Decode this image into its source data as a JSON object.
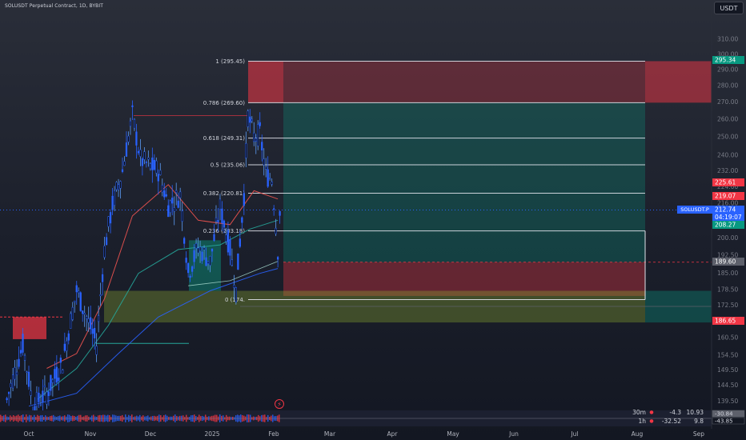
{
  "header": {
    "title": "SOLUSDT Perpetual Contract, 1D, BYBIT",
    "currency": "USDT"
  },
  "symbol_badge": "SOLUSDT.P",
  "chart_data": {
    "type": "candlestick",
    "x_ticks": [
      "Oct",
      "Nov",
      "Dec",
      "2025",
      "Feb",
      "Mar",
      "Apr",
      "May",
      "Jun",
      "Jul",
      "Aug",
      "Sep"
    ],
    "y_scale": "log",
    "y_ticks": [
      "310.00",
      "300.00",
      "290.00",
      "280.00",
      "270.00",
      "260.00",
      "250.00",
      "240.00",
      "232.00",
      "224.00",
      "216.00",
      "208.00",
      "200.00",
      "192.50",
      "185.00",
      "178.50",
      "172.50",
      "166.50",
      "160.50",
      "154.50",
      "149.50",
      "144.50",
      "139.50"
    ],
    "price_labels": [
      {
        "value": "295.34",
        "color": "#089981"
      },
      {
        "value": "225.61",
        "color": "#f23645"
      },
      {
        "value": "219.07",
        "color": "#f23645"
      },
      {
        "value": "212.74",
        "color": "#2962ff"
      },
      {
        "value": "04:19:07",
        "color": "#2962ff"
      },
      {
        "value": "208.27",
        "color": "#089981"
      },
      {
        "value": "189.60",
        "color": "#5d606b"
      },
      {
        "value": "186.65",
        "color": "#f23645"
      }
    ],
    "fib_levels": [
      {
        "label": "1 (295.45)",
        "value": 295.45
      },
      {
        "label": "0.786 (269.60)",
        "value": 269.6
      },
      {
        "label": "0.618 (249.31)",
        "value": 249.31
      },
      {
        "label": "0.5 (235.06)",
        "value": 235.06
      },
      {
        "label": "0.382 (220.81)",
        "value": 220.81
      },
      {
        "label": "0.236 (203.18)",
        "value": 203.18
      },
      {
        "label": "0 (174.",
        "value": 174.6
      }
    ],
    "price_path": [
      [
        "Sep 20",
        140
      ],
      [
        "Sep 28",
        158
      ],
      [
        "Oct 3",
        138
      ],
      [
        "Oct 10",
        142
      ],
      [
        "Oct 18",
        152
      ],
      [
        "Oct 25",
        178
      ],
      [
        "Oct 31",
        166
      ],
      [
        "Nov 4",
        158
      ],
      [
        "Nov 8",
        195
      ],
      [
        "Nov 12",
        215
      ],
      [
        "Nov 17",
        232
      ],
      [
        "Nov 22",
        262
      ],
      [
        "Nov 26",
        238
      ],
      [
        "Nov 30",
        235
      ],
      [
        "Dec 5",
        232
      ],
      [
        "Dec 10",
        215
      ],
      [
        "Dec 16",
        220
      ],
      [
        "Dec 20",
        185
      ],
      [
        "Dec 25",
        196
      ],
      [
        "Dec 31",
        190
      ],
      [
        "Jan 5",
        214
      ],
      [
        "Jan 10",
        195
      ],
      [
        "Jan 13",
        178
      ],
      [
        "Jan 17",
        220
      ],
      [
        "Jan 19",
        262
      ],
      [
        "Jan 22",
        250
      ],
      [
        "Jan 25",
        252
      ],
      [
        "Jan 28",
        230
      ],
      [
        "Jan 31",
        228
      ],
      [
        "Feb 3",
        195
      ],
      [
        "Feb 4",
        212
      ]
    ]
  },
  "bottom_panel": [
    {
      "timeframe": "30m",
      "dot": "●",
      "v1": "-4.3",
      "v2": "10.93"
    },
    {
      "timeframe": "1h",
      "dot": "●",
      "v1": "-32.52",
      "v2": "9.8"
    }
  ],
  "osc_labels": [
    "-30.84",
    "-43.85"
  ],
  "colors": {
    "background": "#131722",
    "up": "#2962ff",
    "down": "#131722",
    "supply_zone": "#f23645",
    "demand_zone": "#089981",
    "ma_green": "#26a69a",
    "ma_red": "#ef5350"
  }
}
